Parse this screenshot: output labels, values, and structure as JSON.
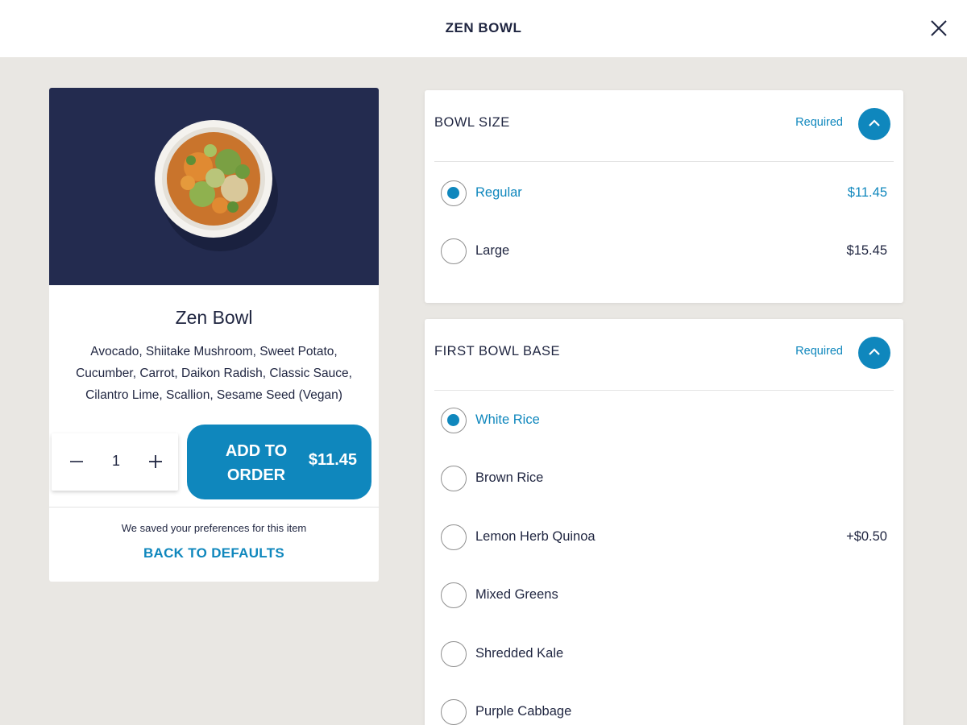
{
  "header": {
    "title": "ZEN BOWL"
  },
  "product": {
    "name": "Zen Bowl",
    "description": "Avocado, Shiitake Mushroom, Sweet Potato, Cucumber, Carrot, Daikon Radish, Classic Sauce, Cilantro Lime, Scallion, Sesame Seed (Vegan)",
    "quantity": "1",
    "add_label": "ADD TO ORDER",
    "add_price": "$11.45",
    "saved_note": "We saved your preferences for this item",
    "back_label": "BACK TO DEFAULTS"
  },
  "sections": [
    {
      "title": "BOWL SIZE",
      "required": "Required",
      "options": [
        {
          "label": "Regular",
          "price": "$11.45",
          "selected": true
        },
        {
          "label": "Large",
          "price": "$15.45",
          "selected": false
        }
      ]
    },
    {
      "title": "FIRST BOWL BASE",
      "required": "Required",
      "options": [
        {
          "label": "White Rice",
          "price": "",
          "selected": true
        },
        {
          "label": "Brown Rice",
          "price": "",
          "selected": false
        },
        {
          "label": "Lemon Herb Quinoa",
          "price": "+$0.50",
          "selected": false
        },
        {
          "label": "Mixed Greens",
          "price": "",
          "selected": false
        },
        {
          "label": "Shredded Kale",
          "price": "",
          "selected": false
        },
        {
          "label": "Purple Cabbage",
          "price": "",
          "selected": false
        }
      ]
    }
  ],
  "colors": {
    "accent": "#0f87bd",
    "navy": "#232b4f",
    "page_bg": "#e9e7e3"
  }
}
